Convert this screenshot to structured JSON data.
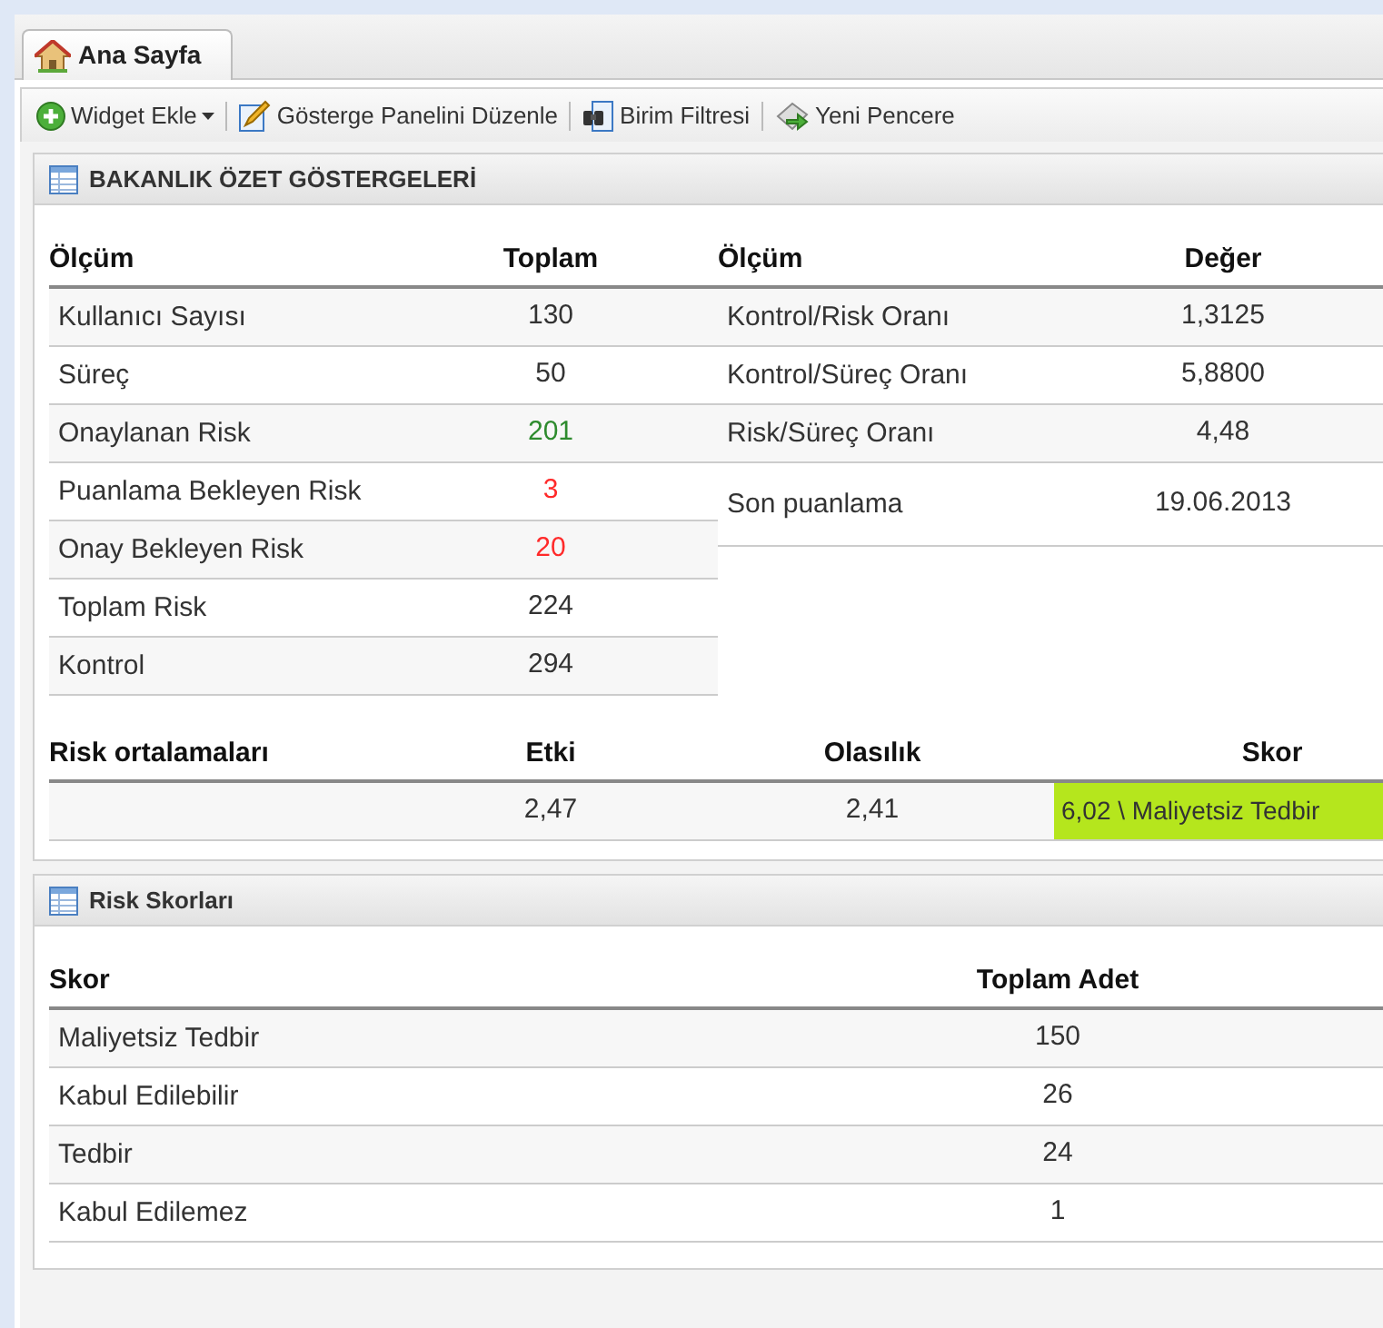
{
  "tabs": [
    {
      "label": "Ana Sayfa",
      "selected": true
    }
  ],
  "toolbar": [
    {
      "kind": "add",
      "label": "Widget Ekle",
      "dropdown": true
    },
    {
      "kind": "edit",
      "label": "Gösterge Panelini Düzenle"
    },
    {
      "kind": "filter",
      "label": "Birim Filtresi"
    },
    {
      "kind": "window",
      "label": "Yeni Pencere"
    }
  ],
  "summary_panel": {
    "title": "BAKANLIK ÖZET GÖSTERGELERİ",
    "left_table": {
      "columns": [
        "Ölçüm",
        "Toplam"
      ],
      "rows": [
        {
          "label": "Kullanıcı Sayısı",
          "value": "130"
        },
        {
          "label": "Süreç",
          "value": "50"
        },
        {
          "label": "Onaylanan Risk",
          "value": "201",
          "color": "#2e8b2e"
        },
        {
          "label": "Puanlama Bekleyen Risk",
          "value": "3",
          "color": "#ff2a2a"
        },
        {
          "label": "Onay Bekleyen Risk",
          "value": "20",
          "color": "#ff2a2a"
        },
        {
          "label": "Toplam Risk",
          "value": "224"
        },
        {
          "label": "Kontrol",
          "value": "294"
        }
      ]
    },
    "right_table": {
      "columns": [
        "Ölçüm",
        "Değer"
      ],
      "rows": [
        {
          "label": "Kontrol/Risk Oranı",
          "value": "1,3125"
        },
        {
          "label": "Kontrol/Süreç Oranı",
          "value": "5,8800"
        },
        {
          "label": "Risk/Süreç Oranı",
          "value": "4,48"
        },
        {
          "label": "Son puanlama",
          "value": "19.06.2013"
        }
      ]
    },
    "averages": {
      "columns": [
        "Risk ortalamaları",
        "Etki",
        "Olasılık",
        "Skor"
      ],
      "etki": "2,47",
      "olasilik": "2,41",
      "skor": "6,02 \\ Maliyetsiz Tedbir",
      "color": "#b5e61d"
    }
  },
  "scores_panel": {
    "title": "Risk Skorları",
    "columns": [
      "Skor",
      "Toplam Adet"
    ],
    "rows": [
      {
        "label": "Maliyetsiz Tedbir",
        "value": "150"
      },
      {
        "label": "Kabul Edilebilir",
        "value": "26"
      },
      {
        "label": "Tedbir",
        "value": "24"
      },
      {
        "label": "Kabul Edilemez",
        "value": "1"
      }
    ]
  }
}
